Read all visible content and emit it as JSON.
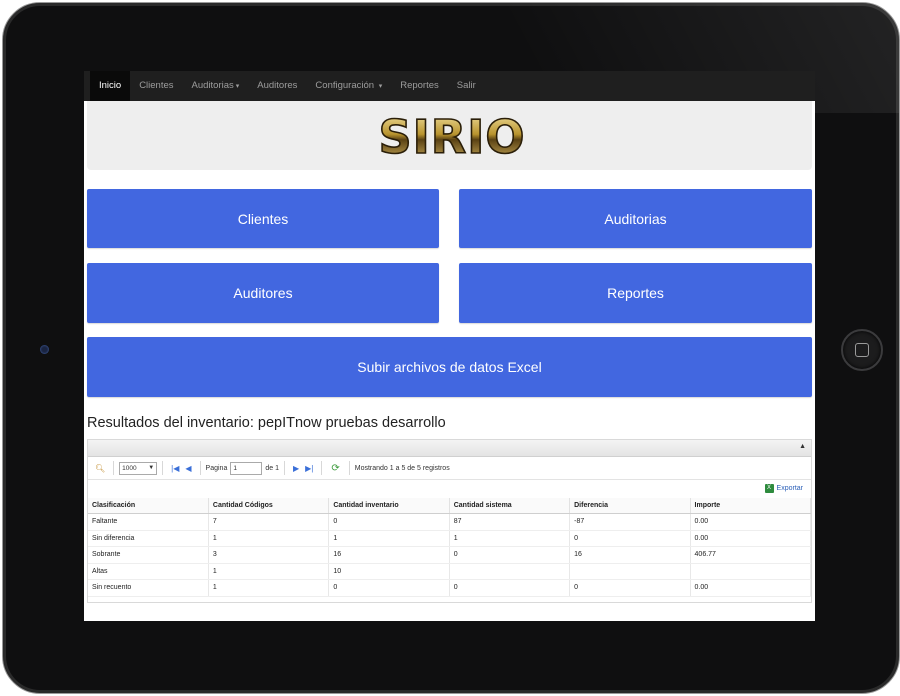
{
  "nav": {
    "items": [
      {
        "label": "Inicio",
        "active": true,
        "dropdown": false
      },
      {
        "label": "Clientes",
        "active": false,
        "dropdown": false
      },
      {
        "label": "Auditorias",
        "active": false,
        "dropdown": true
      },
      {
        "label": "Auditores",
        "active": false,
        "dropdown": false
      },
      {
        "label": "Configuración",
        "active": false,
        "dropdown": true
      },
      {
        "label": "Reportes",
        "active": false,
        "dropdown": false
      },
      {
        "label": "Salir",
        "active": false,
        "dropdown": false
      }
    ]
  },
  "logo": {
    "text": "SIRIO"
  },
  "tiles": {
    "clientes": "Clientes",
    "auditorias": "Auditorias",
    "auditores": "Auditores",
    "reportes": "Reportes",
    "subir": "Subir archivos de datos Excel"
  },
  "results": {
    "title": "Resultados del inventario: pepITnow pruebas desarrollo",
    "pager": {
      "page_size": "1000",
      "page_label": "Pagina",
      "page_value": "1",
      "of_label": "de 1",
      "status": "Mostrando 1 a 5 de 5 registros"
    },
    "export_label": "Exportar",
    "columns": [
      "Clasificación",
      "Cantidad Códigos",
      "Cantidad inventario",
      "Cantidad sistema",
      "Diferencia",
      "Importe"
    ],
    "rows": [
      [
        "Faltante",
        "7",
        "0",
        "87",
        "-87",
        "0.00"
      ],
      [
        "Sin diferencia",
        "1",
        "1",
        "1",
        "0",
        "0.00"
      ],
      [
        "Sobrante",
        "3",
        "16",
        "0",
        "16",
        "406.77"
      ],
      [
        "Altas",
        "1",
        "10",
        "",
        "",
        ""
      ],
      [
        "Sin recuento",
        "1",
        "0",
        "0",
        "0",
        "0.00"
      ]
    ]
  },
  "colors": {
    "tile": "#4267e0",
    "nav_bg": "#1f1f1f"
  }
}
